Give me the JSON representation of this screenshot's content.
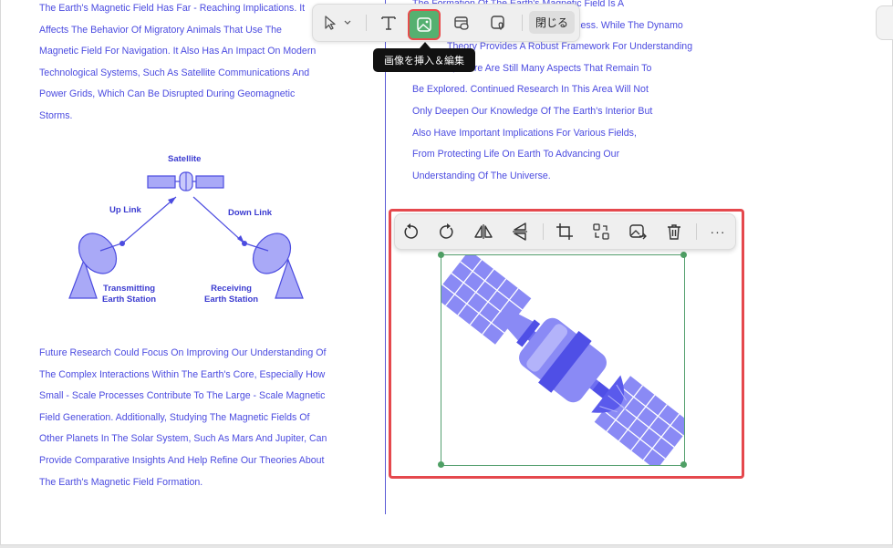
{
  "toolbar": {
    "close_label": "閉じる",
    "tooltip": "画像を挿入＆編集",
    "icons": [
      "cursor-icon",
      "chevron-down-icon",
      "text-icon",
      "image-insert-icon",
      "link-image-icon",
      "place-image-icon"
    ]
  },
  "left_column": {
    "top_paragraph": [
      "The Earth's Magnetic Field Has Far - Reaching Implications. It",
      "Affects The Behavior Of Migratory Animals That Use The",
      "Magnetic Field For Navigation. It Also Has An Impact On Modern",
      "Technological Systems, Such As Satellite Communications And",
      "Power Grids, Which Can Be Disrupted During Geomagnetic",
      "Storms."
    ],
    "bottom_paragraph": [
      "Future Research Could Focus On Improving Our Understanding Of",
      "The Complex Interactions Within The Earth's Core, Especially How",
      "Small - Scale Processes Contribute To The Large - Scale Magnetic",
      "Field Generation. Additionally, Studying The Magnetic Fields Of",
      "Other Planets In The Solar System, Such As Mars And Jupiter, Can",
      "Provide Comparative Insights And Help Refine Our Theories About",
      "The Earth's Magnetic Field Formation."
    ]
  },
  "right_column": {
    "top_paragraph": [
      "The Formation Of The Earth's Magnetic Field Is A",
      "Complex Process. While The Dynamo",
      "Theory Provides A Robust Framework For Understanding",
      "It, There Are Still Many Aspects That Remain To",
      "Be Explored. Continued Research In This Area Will Not",
      "Only Deepen Our Knowledge Of The Earth's Interior But",
      "Also Have Important Implications For Various Fields,",
      "From Protecting Life On Earth To Advancing Our",
      "Understanding Of The Universe."
    ]
  },
  "diagram": {
    "satellite": "Satellite",
    "up_link": "Up Link",
    "down_link": "Down Link",
    "transmitting_1": "Transmitting",
    "transmitting_2": "Earth Station",
    "receiving_1": "Receiving",
    "receiving_2": "Earth Station"
  },
  "image_toolbar": {
    "more": "···",
    "icons": [
      "rotate-left-icon",
      "rotate-right-icon",
      "flip-horizontal-icon",
      "flip-vertical-icon",
      "crop-icon",
      "replace-image-icon",
      "extract-image-icon",
      "delete-icon",
      "more-icon"
    ]
  },
  "colors": {
    "text": "#4b4be0",
    "accent_green": "#55b070",
    "selection_red": "#e5484d",
    "satellite_light": "#8a8af5",
    "satellite_dark": "#4f4fe6"
  }
}
